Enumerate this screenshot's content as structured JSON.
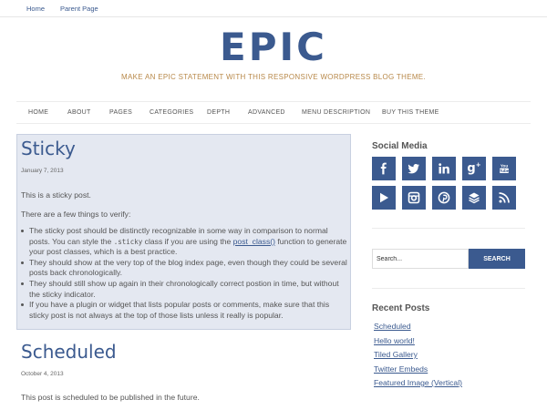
{
  "topnav": {
    "home": "Home",
    "parent": "Parent Page"
  },
  "site": {
    "title": "EPIC",
    "tagline": "MAKE AN EPIC STATEMENT WITH THIS RESPONSIVE WORDPRESS BLOG THEME."
  },
  "mainnav": [
    "HOME",
    "ABOUT",
    "PAGES",
    "CATEGORIES",
    "DEPTH",
    "ADVANCED",
    "MENU DESCRIPTION",
    "BUY THIS THEME"
  ],
  "sticky": {
    "title": "Sticky",
    "date": "January 7, 2013",
    "p1": "This is a sticky post.",
    "p2": "There are a few things to verify:",
    "b1_pre": "The sticky post should be distinctly recognizable in some way in comparison to normal posts. You can style the ",
    "b1_code": ".sticky",
    "b1_mid": " class if you are using the ",
    "b1_link": "post_class()",
    "b1_post": " function to generate your post classes, which is a best practice.",
    "b2": "They should show at the very top of the blog index page, even though they could be several posts back chronologically.",
    "b3": "They should still show up again in their chronologically correct postion in time, but without the sticky indicator.",
    "b4": "If you have a plugin or widget that lists popular posts or comments, make sure that this sticky post is not always at the top of those lists unless it really is popular."
  },
  "scheduled": {
    "title": "Scheduled",
    "date": "October 4, 2013",
    "p1": "This post is scheduled to be published in the future."
  },
  "sidebar": {
    "social_title": "Social Media",
    "social_icons": [
      "facebook-icon",
      "twitter-icon",
      "linkedin-icon",
      "google-plus-icon",
      "youtube-icon",
      "play-icon",
      "instagram-icon",
      "pinterest-icon",
      "layers-icon",
      "rss-icon"
    ],
    "search_value": "Search...",
    "search_button": "SEARCH",
    "recent_title": "Recent Posts",
    "recent_posts": [
      "Scheduled",
      "Hello world!",
      "Tiled Gallery",
      "Twitter Embeds",
      "Featured Image (Vertical)"
    ]
  },
  "colors": {
    "accent": "#3b5a8f",
    "tagline": "#b8894a",
    "sticky_bg": "#e4e8f1"
  }
}
